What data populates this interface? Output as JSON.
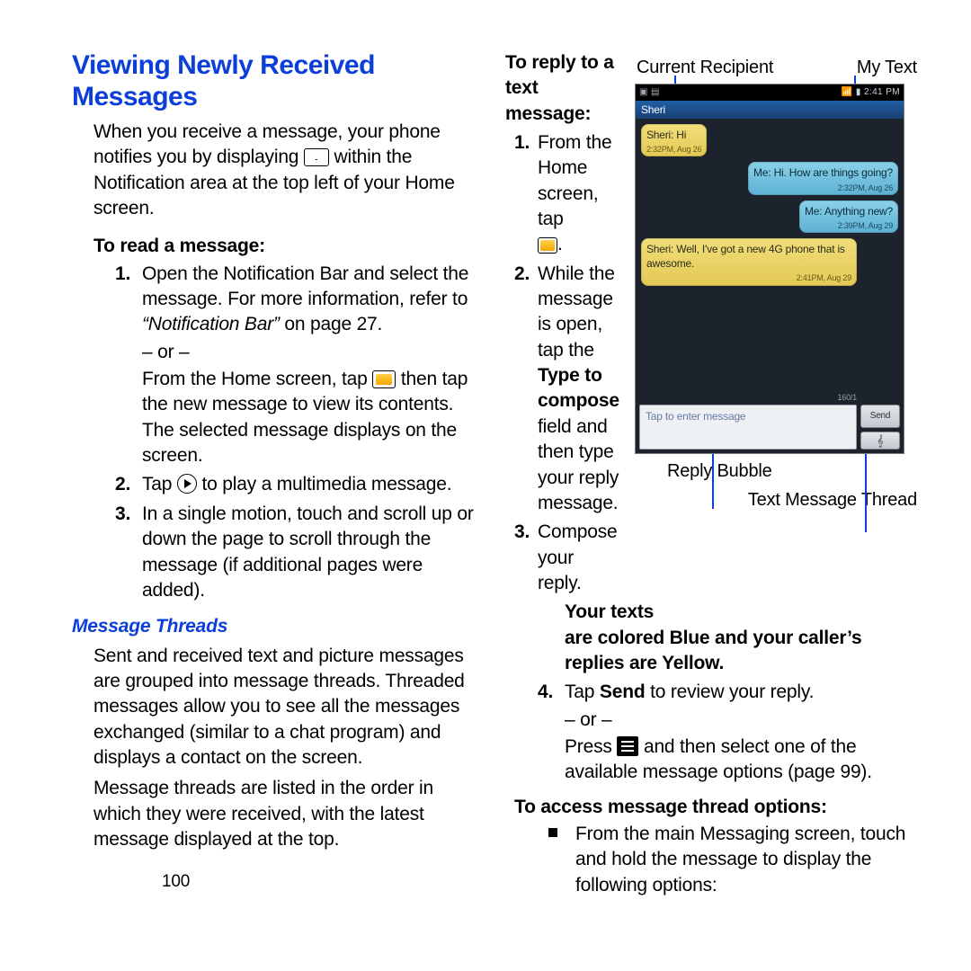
{
  "left": {
    "title": "Viewing Newly Received Messages",
    "intro_a": "When you receive a message, your phone notifies you by displaying ",
    "intro_b": " within the Notification area at the top left of your Home screen.",
    "read_label": "To read a message:",
    "read_1a": "Open the Notification Bar and select the message. For more information, refer to ",
    "read_1_ref": "“Notification Bar” ",
    "read_1b": " on page 27.",
    "or": "– or –",
    "read_1c_a": "From the Home screen, tap ",
    "read_1c_b": " then tap the new message to view its contents. The selected message displays on the screen.",
    "read_2a": "Tap ",
    "read_2b": " to play a multimedia message.",
    "read_3": "In a single motion, touch and scroll up or down the page to scroll through the message (if additional pages were added).",
    "threads_title": "Message Threads",
    "threads_p1": "Sent and received text and picture messages are grouped into message threads. Threaded messages allow you to see all the messages exchanged (similar to a chat program) and displays a contact on the screen.",
    "threads_p2": "Message threads are listed in the order in which they were received, with the latest message displayed at the top.",
    "pagenum": "100"
  },
  "right": {
    "reply_label": "To reply to a text message:",
    "label_current": "Current Recipient",
    "label_mytext": "My Text",
    "r1a": "From the Home screen, tap ",
    "r1b": ".",
    "r2a": "While the message is open, tap the ",
    "r2_bold": "Type to compose",
    "r2b": " field and then type your reply message.",
    "r3": "Compose your reply.",
    "your_texts": "Your texts",
    "color_note": "are colored Blue and your caller’s replies are Yellow.",
    "r4a": "Tap ",
    "r4_bold": "Send",
    "r4b": " to review your reply.",
    "r4c_a": "Press ",
    "r4c_b": " and then select one of the available message options (page 99).",
    "access_label": "To access message thread options:",
    "access_1": "From the main Messaging screen, touch and hold the message to display the following options:",
    "annot_reply": "Reply Bubble",
    "annot_thread": "Text Message Thread"
  },
  "phone": {
    "time": "2:41 PM",
    "contact": "Sheri",
    "m1": "Sheri: Hi",
    "t1": "2:32PM, Aug 26",
    "m2": "Me: Hi. How are things going?",
    "t2": "2:32PM, Aug 26",
    "m3": "Me: Anything new?",
    "t3": "2:39PM, Aug 29",
    "m4": "Sheri: Well, I've got a new 4G phone that is awesome.",
    "t4": "2:41PM, Aug 29",
    "compose_ph": "Tap to enter message",
    "send": "Send",
    "counter": "160/1"
  }
}
